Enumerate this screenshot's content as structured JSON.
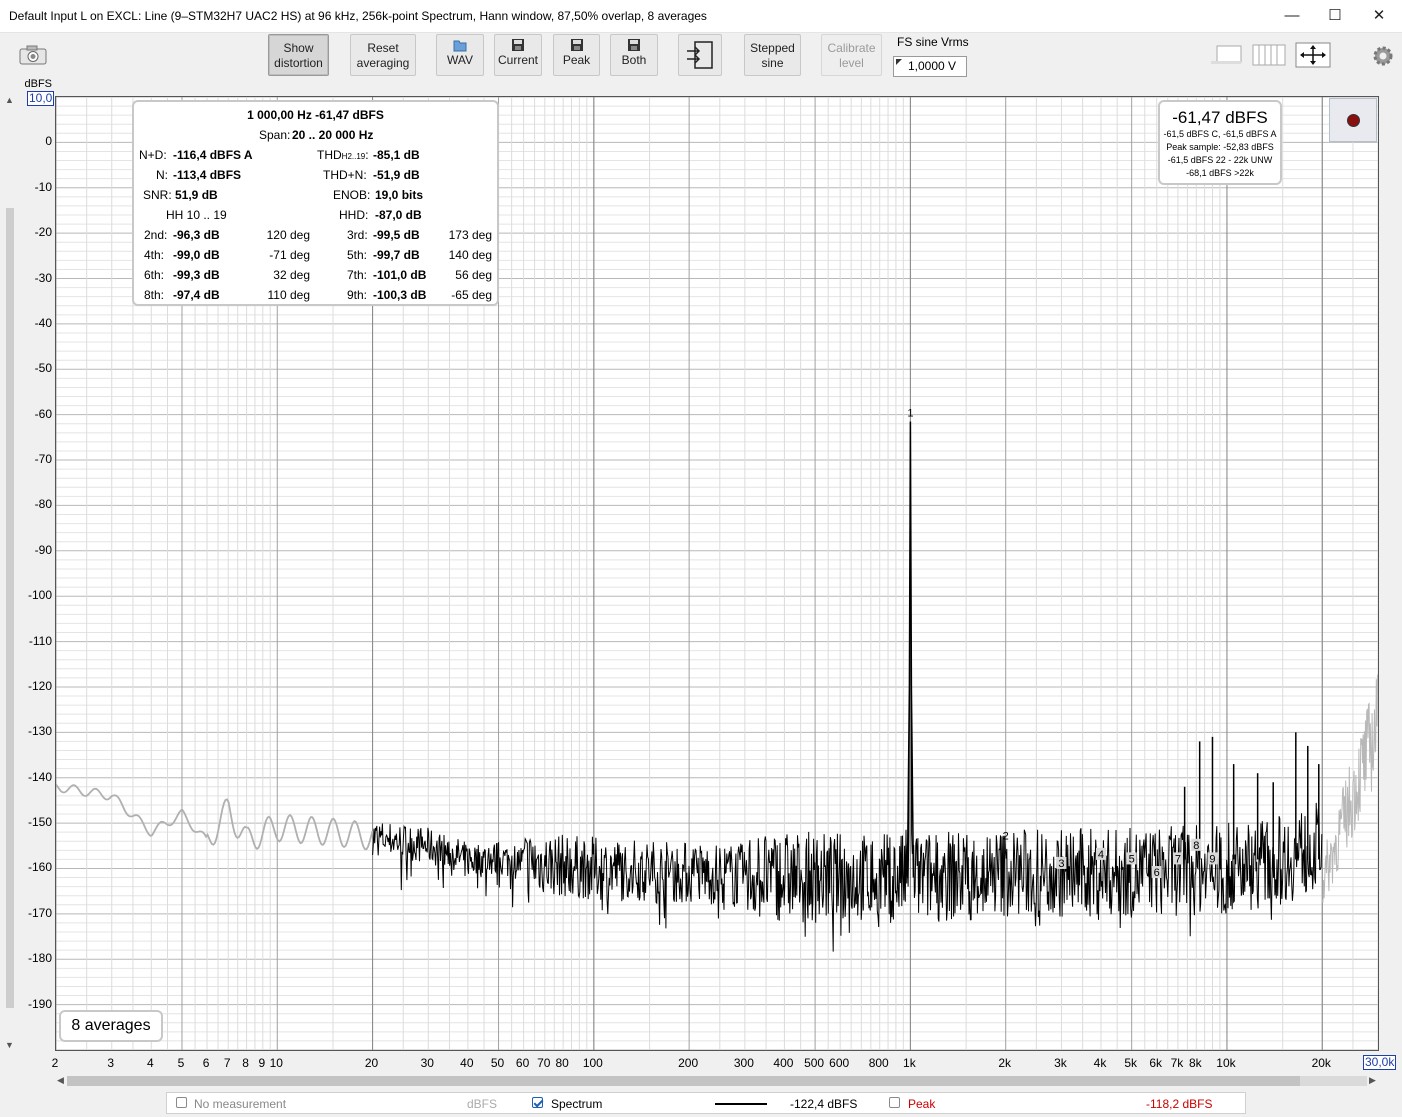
{
  "window": {
    "title": "Default Input L on EXCL: Line (9–STM32H7 UAC2 HS) at 96 kHz, 256k-point Spectrum, Hann window, 87,50% overlap, 8 averages",
    "minimize": "—",
    "maximize": "☐",
    "close": "✕"
  },
  "toolbar": {
    "show_distortion": [
      "Show",
      "distortion"
    ],
    "reset_averaging": [
      "Reset",
      "averaging"
    ],
    "wav": "WAV",
    "current": "Current",
    "peak": "Peak",
    "both": "Both",
    "stepped_sine": [
      "Stepped",
      "sine"
    ],
    "calibrate_level": [
      "Calibrate",
      "level"
    ],
    "fs_label": "FS sine Vrms",
    "fs_value": "1,0000 V"
  },
  "plot": {
    "y_unit": "dBFS",
    "y_top_box": "10,0",
    "x_right_box": "30,0k",
    "y_ticks": [
      "0",
      "-10",
      "-20",
      "-30",
      "-40",
      "-50",
      "-60",
      "-70",
      "-80",
      "-90",
      "-100",
      "-110",
      "-120",
      "-130",
      "-140",
      "-150",
      "-160",
      "-170",
      "-180",
      "-190"
    ],
    "x_ticks": [
      "2",
      "3",
      "4",
      "5",
      "6",
      "7",
      "8",
      "9",
      "10",
      "20",
      "30",
      "40",
      "50",
      "60",
      "70",
      "80",
      "100",
      "200",
      "300",
      "400",
      "500",
      "600",
      "800",
      "1k",
      "2k",
      "3k",
      "4k",
      "5k",
      "6k",
      "7k",
      "8k",
      "10k",
      "20k"
    ],
    "averages_badge": "8 averages"
  },
  "info": {
    "header": "1 000,00 Hz  -61,47 dBFS",
    "span_label": "Span:",
    "span_value": "20 .. 20 000 Hz",
    "nd_label": "N+D:",
    "nd_value": "-116,4 dBFS A",
    "thd_label": "THD",
    "thd_sub": "H2..19",
    "thd_colon": ":",
    "thd_value": "-85,1 dB",
    "n_label": "N:",
    "n_value": "-113,4 dBFS",
    "thdn_label": "THD+N:",
    "thdn_value": "-51,9 dB",
    "snr_label": "SNR:",
    "snr_value": "51,9 dB",
    "enob_label": "ENOB:",
    "enob_value": "19,0 bits",
    "hh_label": "HH 10 .. 19",
    "hhd_label": "HHD:",
    "hhd_value": "-87,0 dB",
    "harmonics": [
      {
        "l": "2nd:",
        "v": "-96,3 dB",
        "p": "120 deg",
        "l2": "3rd:",
        "v2": "-99,5 dB",
        "p2": "173 deg"
      },
      {
        "l": "4th:",
        "v": "-99,0 dB",
        "p": "-71 deg",
        "l2": "5th:",
        "v2": "-99,7 dB",
        "p2": "140 deg"
      },
      {
        "l": "6th:",
        "v": "-99,3 dB",
        "p": "32 deg",
        "l2": "7th:",
        "v2": "-101,0 dB",
        "p2": "56 deg"
      },
      {
        "l": "8th:",
        "v": "-97,4 dB",
        "p": "110 deg",
        "l2": "9th:",
        "v2": "-100,3 dB",
        "p2": "-65 deg"
      }
    ]
  },
  "level": {
    "big": "-61,47 dBFS",
    "lines": [
      "-61,5 dBFS C, -61,5 dBFS A",
      "Peak sample: -52,83 dBFS",
      "-61,5 dBFS 22 - 22k UNW",
      "-68,1 dBFS >22k"
    ]
  },
  "legend": {
    "no_measurement": "No measurement",
    "unit": "dBFS",
    "spectrum": "Spectrum",
    "spectrum_value": "-122,4 dBFS",
    "peak": "Peak",
    "peak_value": "-118,2 dBFS",
    "peak_color": "#cc0000"
  },
  "chart_data": {
    "type": "line",
    "xscale": "log",
    "xlim": [
      2,
      30000
    ],
    "ylim": [
      -200,
      10
    ],
    "ylabel": "dBFS",
    "grid": true,
    "series": [
      {
        "name": "Spectrum",
        "x": [
          2,
          3,
          4,
          5,
          6,
          7,
          8,
          9,
          10,
          15,
          20,
          30,
          40,
          50,
          100,
          200,
          500,
          950,
          990,
          1000,
          1010,
          1050,
          2000,
          5000,
          10000,
          15000,
          20000
        ],
        "y": [
          -142,
          -144,
          -152,
          -148,
          -154,
          -147,
          -154,
          -152,
          -151,
          -152,
          -153,
          -155,
          -158,
          -158,
          -160,
          -161,
          -162,
          -162,
          -160,
          -61.5,
          -160,
          -162,
          -161,
          -161,
          -160,
          -158,
          -155
        ]
      }
    ],
    "markers": [
      {
        "label": "1",
        "x": 1000,
        "y": -61.5
      },
      {
        "label": "2",
        "x": 2000,
        "y": -153
      },
      {
        "label": "3",
        "x": 3000,
        "y": -159
      },
      {
        "label": "4",
        "x": 4000,
        "y": -157
      },
      {
        "label": "5",
        "x": 5000,
        "y": -158
      },
      {
        "label": "6",
        "x": 6000,
        "y": -161
      },
      {
        "label": "7",
        "x": 7000,
        "y": -158
      },
      {
        "label": "8",
        "x": 8000,
        "y": -155
      },
      {
        "label": "9",
        "x": 9000,
        "y": -158
      }
    ],
    "spurs": [
      {
        "x": 7350,
        "y": -142
      },
      {
        "x": 8200,
        "y": -132
      },
      {
        "x": 9000,
        "y": -131
      },
      {
        "x": 10500,
        "y": -137
      },
      {
        "x": 12500,
        "y": -139
      },
      {
        "x": 14000,
        "y": -141
      },
      {
        "x": 16500,
        "y": -130
      },
      {
        "x": 18000,
        "y": -133
      },
      {
        "x": 19500,
        "y": -137
      }
    ]
  }
}
